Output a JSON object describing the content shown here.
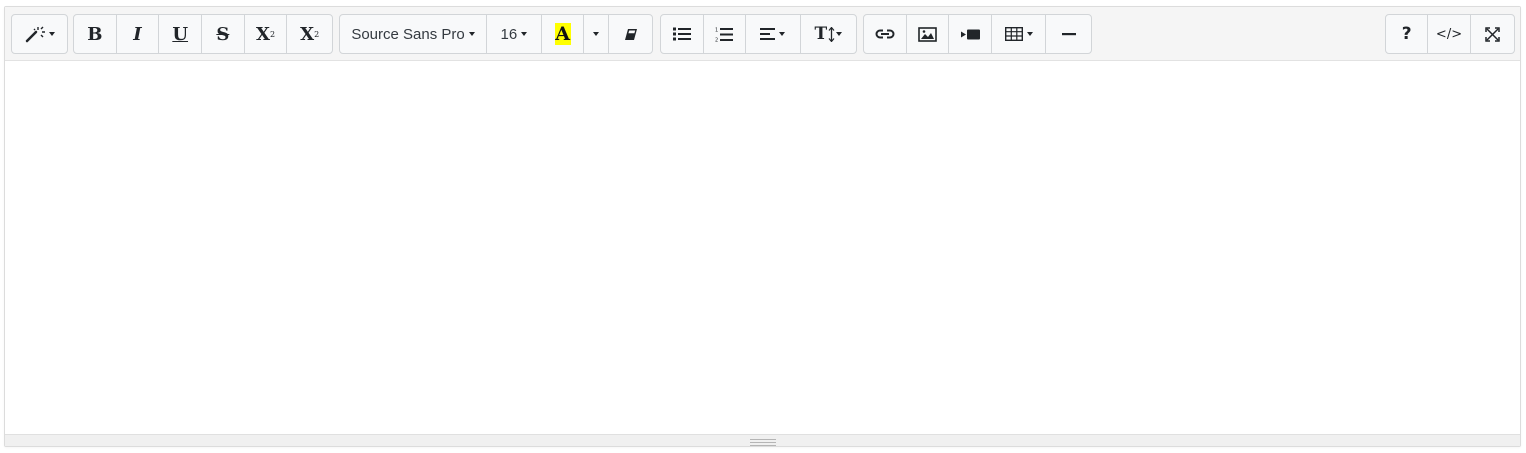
{
  "toolbar": {
    "style_button": {
      "icon": "magic-wand-icon"
    },
    "font": {
      "bold": "B",
      "italic": "I",
      "underline": "U",
      "strikethrough": "S",
      "superscript_base": "X",
      "superscript_mark": "2",
      "subscript_base": "X",
      "subscript_mark": "2"
    },
    "fontname": {
      "selected": "Source Sans Pro"
    },
    "fontsize": {
      "selected": "16"
    },
    "color": {
      "letter": "A",
      "highlight": "#ffff00",
      "icon": "text-color-icon"
    },
    "clear_format": {
      "icon": "eraser-icon"
    },
    "paragraph": {
      "ul_icon": "unordered-list-icon",
      "ol_icon": "ordered-list-icon",
      "align_icon": "align-left-icon",
      "height_label": "T"
    },
    "insert": {
      "link_icon": "link-icon",
      "picture_icon": "picture-icon",
      "video_icon": "video-icon",
      "table_icon": "table-icon",
      "hr_icon": "horizontal-rule-icon"
    },
    "misc": {
      "help_label": "?",
      "codeview_label": "</>",
      "fullscreen_icon": "fullscreen-icon"
    }
  },
  "editor": {
    "content": ""
  }
}
